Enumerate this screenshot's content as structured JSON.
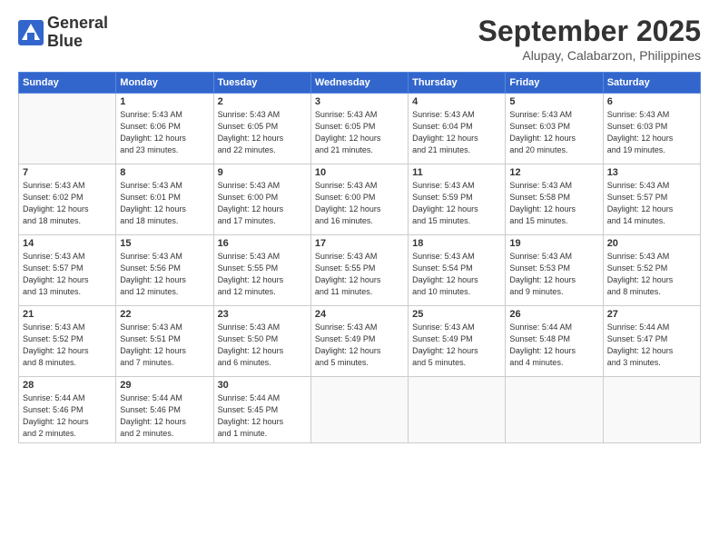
{
  "header": {
    "logo_line1": "General",
    "logo_line2": "Blue",
    "month": "September 2025",
    "location": "Alupay, Calabarzon, Philippines"
  },
  "weekdays": [
    "Sunday",
    "Monday",
    "Tuesday",
    "Wednesday",
    "Thursday",
    "Friday",
    "Saturday"
  ],
  "weeks": [
    [
      {
        "num": "",
        "info": ""
      },
      {
        "num": "1",
        "info": "Sunrise: 5:43 AM\nSunset: 6:06 PM\nDaylight: 12 hours\nand 23 minutes."
      },
      {
        "num": "2",
        "info": "Sunrise: 5:43 AM\nSunset: 6:05 PM\nDaylight: 12 hours\nand 22 minutes."
      },
      {
        "num": "3",
        "info": "Sunrise: 5:43 AM\nSunset: 6:05 PM\nDaylight: 12 hours\nand 21 minutes."
      },
      {
        "num": "4",
        "info": "Sunrise: 5:43 AM\nSunset: 6:04 PM\nDaylight: 12 hours\nand 21 minutes."
      },
      {
        "num": "5",
        "info": "Sunrise: 5:43 AM\nSunset: 6:03 PM\nDaylight: 12 hours\nand 20 minutes."
      },
      {
        "num": "6",
        "info": "Sunrise: 5:43 AM\nSunset: 6:03 PM\nDaylight: 12 hours\nand 19 minutes."
      }
    ],
    [
      {
        "num": "7",
        "info": "Sunrise: 5:43 AM\nSunset: 6:02 PM\nDaylight: 12 hours\nand 18 minutes."
      },
      {
        "num": "8",
        "info": "Sunrise: 5:43 AM\nSunset: 6:01 PM\nDaylight: 12 hours\nand 18 minutes."
      },
      {
        "num": "9",
        "info": "Sunrise: 5:43 AM\nSunset: 6:00 PM\nDaylight: 12 hours\nand 17 minutes."
      },
      {
        "num": "10",
        "info": "Sunrise: 5:43 AM\nSunset: 6:00 PM\nDaylight: 12 hours\nand 16 minutes."
      },
      {
        "num": "11",
        "info": "Sunrise: 5:43 AM\nSunset: 5:59 PM\nDaylight: 12 hours\nand 15 minutes."
      },
      {
        "num": "12",
        "info": "Sunrise: 5:43 AM\nSunset: 5:58 PM\nDaylight: 12 hours\nand 15 minutes."
      },
      {
        "num": "13",
        "info": "Sunrise: 5:43 AM\nSunset: 5:57 PM\nDaylight: 12 hours\nand 14 minutes."
      }
    ],
    [
      {
        "num": "14",
        "info": "Sunrise: 5:43 AM\nSunset: 5:57 PM\nDaylight: 12 hours\nand 13 minutes."
      },
      {
        "num": "15",
        "info": "Sunrise: 5:43 AM\nSunset: 5:56 PM\nDaylight: 12 hours\nand 12 minutes."
      },
      {
        "num": "16",
        "info": "Sunrise: 5:43 AM\nSunset: 5:55 PM\nDaylight: 12 hours\nand 12 minutes."
      },
      {
        "num": "17",
        "info": "Sunrise: 5:43 AM\nSunset: 5:55 PM\nDaylight: 12 hours\nand 11 minutes."
      },
      {
        "num": "18",
        "info": "Sunrise: 5:43 AM\nSunset: 5:54 PM\nDaylight: 12 hours\nand 10 minutes."
      },
      {
        "num": "19",
        "info": "Sunrise: 5:43 AM\nSunset: 5:53 PM\nDaylight: 12 hours\nand 9 minutes."
      },
      {
        "num": "20",
        "info": "Sunrise: 5:43 AM\nSunset: 5:52 PM\nDaylight: 12 hours\nand 8 minutes."
      }
    ],
    [
      {
        "num": "21",
        "info": "Sunrise: 5:43 AM\nSunset: 5:52 PM\nDaylight: 12 hours\nand 8 minutes."
      },
      {
        "num": "22",
        "info": "Sunrise: 5:43 AM\nSunset: 5:51 PM\nDaylight: 12 hours\nand 7 minutes."
      },
      {
        "num": "23",
        "info": "Sunrise: 5:43 AM\nSunset: 5:50 PM\nDaylight: 12 hours\nand 6 minutes."
      },
      {
        "num": "24",
        "info": "Sunrise: 5:43 AM\nSunset: 5:49 PM\nDaylight: 12 hours\nand 5 minutes."
      },
      {
        "num": "25",
        "info": "Sunrise: 5:43 AM\nSunset: 5:49 PM\nDaylight: 12 hours\nand 5 minutes."
      },
      {
        "num": "26",
        "info": "Sunrise: 5:44 AM\nSunset: 5:48 PM\nDaylight: 12 hours\nand 4 minutes."
      },
      {
        "num": "27",
        "info": "Sunrise: 5:44 AM\nSunset: 5:47 PM\nDaylight: 12 hours\nand 3 minutes."
      }
    ],
    [
      {
        "num": "28",
        "info": "Sunrise: 5:44 AM\nSunset: 5:46 PM\nDaylight: 12 hours\nand 2 minutes."
      },
      {
        "num": "29",
        "info": "Sunrise: 5:44 AM\nSunset: 5:46 PM\nDaylight: 12 hours\nand 2 minutes."
      },
      {
        "num": "30",
        "info": "Sunrise: 5:44 AM\nSunset: 5:45 PM\nDaylight: 12 hours\nand 1 minute."
      },
      {
        "num": "",
        "info": ""
      },
      {
        "num": "",
        "info": ""
      },
      {
        "num": "",
        "info": ""
      },
      {
        "num": "",
        "info": ""
      }
    ]
  ]
}
